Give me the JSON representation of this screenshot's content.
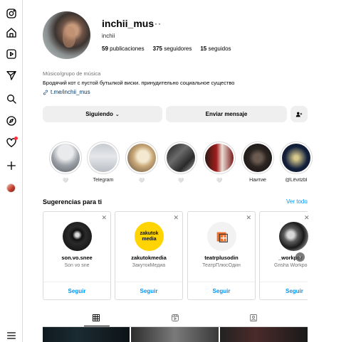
{
  "nav": {
    "icons": [
      "instagram-icon",
      "home-icon",
      "reels-icon",
      "send-icon",
      "search-icon",
      "explore-icon",
      "heart-icon",
      "create-icon",
      "profile-avatar",
      "menu-icon"
    ]
  },
  "profile": {
    "username": "inchii_mus",
    "more": "···",
    "full_name": "inchii",
    "posts_count": "59",
    "posts_label": "publicaciones",
    "followers_count": "375",
    "followers_label": "seguidores",
    "following_count": "15",
    "following_label": "seguidos",
    "category": "Músico/grupo de música",
    "bio": "Бродячий кот с пустой бутылкой виски. принудительно социальное существо",
    "link": "t.me/inchii_mus"
  },
  "actions": {
    "following_label": "Siguiendo",
    "message_label": "Enviar mensaje"
  },
  "highlights": [
    {
      "label": "🤍"
    },
    {
      "label": "Telegram"
    },
    {
      "label": "🤍"
    },
    {
      "label": "🤍"
    },
    {
      "label": "🤍"
    },
    {
      "label": "Наитие"
    },
    {
      "label": "@Lёvitzbl"
    }
  ],
  "suggestions": {
    "title": "Sugerencias para ti",
    "see_all": "Ver todo",
    "follow_label": "Seguir",
    "cards": [
      {
        "name": "son.vo.snee",
        "sub": "Son vo sne"
      },
      {
        "name": "zakutokmedia",
        "sub": "ЗакутокМедиа"
      },
      {
        "name": "teatrplusodin",
        "sub": "ТеатрПлюсОдин"
      },
      {
        "name": "_workpor",
        "sub": "Grisha Workpo"
      }
    ]
  },
  "colors": {
    "link": "#00376b",
    "accent": "#0095f6",
    "button_bg": "#efefef",
    "notification": "#ff3040"
  }
}
